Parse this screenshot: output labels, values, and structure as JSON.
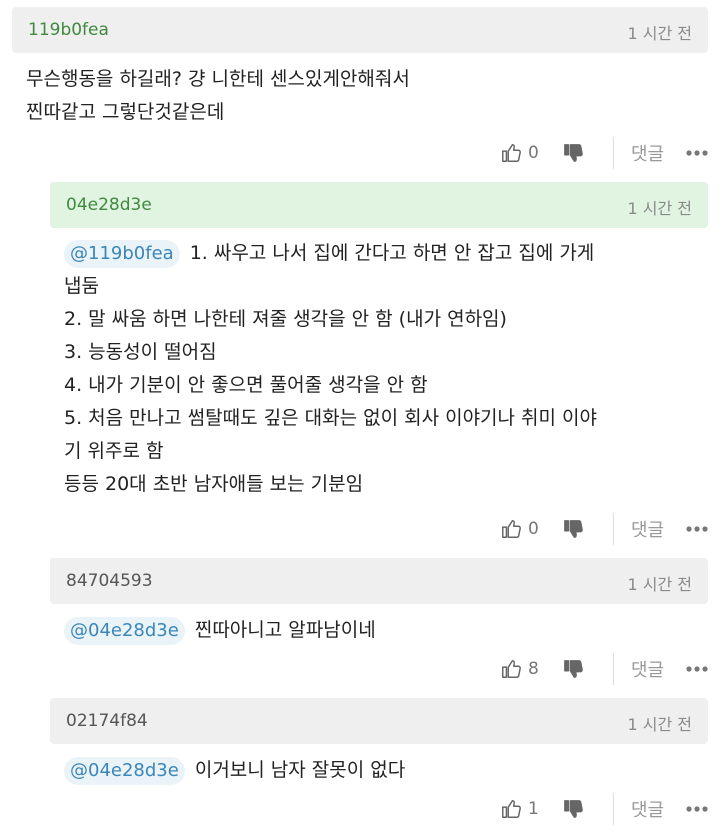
{
  "comments": [
    {
      "author": "119b0fea",
      "time": "1 시간 전",
      "mention": "",
      "lines": [
        "무슨행동을 하길래? 걍 니한테 센스있게안해줘서",
        "찐따같고 그렇단것같은데"
      ],
      "likes": "0",
      "reply_label": "댓글"
    },
    {
      "author": "04e28d3e",
      "time": "1 시간 전",
      "mention": "@119b0fea",
      "first_line": "1. 싸우고 나서 집에 간다고 하면 안 잡고 집에 가게",
      "lines": [
        "냅둠",
        "2. 말 싸움 하면 나한테 져줄 생각을 안 함 (내가 연하임)",
        "3. 능동성이 떨어짐",
        "4. 내가 기분이 안 좋으면 풀어줄 생각을 안 함",
        "5. 처음 만나고 썸탈때도 깊은 대화는 없이 회사 이야기나 취미 이야",
        "기 위주로 함",
        "등등 20대 초반 남자애들 보는 기분임"
      ],
      "likes": "0",
      "reply_label": "댓글"
    },
    {
      "author": "84704593",
      "time": "1 시간 전",
      "mention": "@04e28d3e",
      "first_line": "찐따아니고 알파남이네",
      "likes": "8",
      "reply_label": "댓글"
    },
    {
      "author": "02174f84",
      "time": "1 시간 전",
      "mention": "@04e28d3e",
      "first_line": "이거보니 남자 잘못이 없다",
      "likes": "1",
      "reply_label": "댓글"
    }
  ],
  "icons": {
    "like": "thumbs-up-icon",
    "dislike": "thumbs-down-icon",
    "more": "more-dots-icon"
  },
  "colors": {
    "header_grey": "#efefef",
    "header_green": "#e0f4e1",
    "author_green": "#3f8a3f",
    "mention_blue": "#3a86b8"
  }
}
